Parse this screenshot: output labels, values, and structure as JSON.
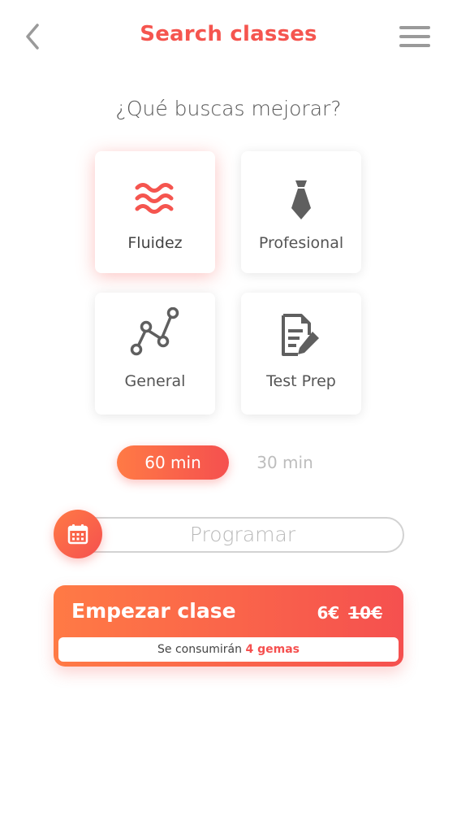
{
  "header": {
    "title": "Search classes",
    "back_icon": "chevron-left-icon",
    "menu_icon": "hamburger-menu-icon"
  },
  "question": "¿Qué buscas mejorar?",
  "goals": [
    {
      "label": "Fluidez",
      "icon": "waves-icon",
      "selected": true
    },
    {
      "label": "Profesional",
      "icon": "tie-icon",
      "selected": false
    },
    {
      "label": "General",
      "icon": "line-chart-icon",
      "selected": false
    },
    {
      "label": "Test Prep",
      "icon": "document-edit-icon",
      "selected": false
    }
  ],
  "duration": {
    "options": [
      "60 min",
      "30 min"
    ],
    "selected": "60 min"
  },
  "schedule": {
    "placeholder": "Programar",
    "icon": "calendar-icon"
  },
  "start": {
    "label": "Empezar clase",
    "price": "6€",
    "old_price": "10€",
    "gems_prefix": "Se consumirán",
    "gems_count": "4 gemas"
  },
  "colors": {
    "accent": "#f5554f",
    "gradient_start": "#ff7a45",
    "gradient_end": "#f5504f",
    "icon_gray": "#5f5f5f"
  }
}
